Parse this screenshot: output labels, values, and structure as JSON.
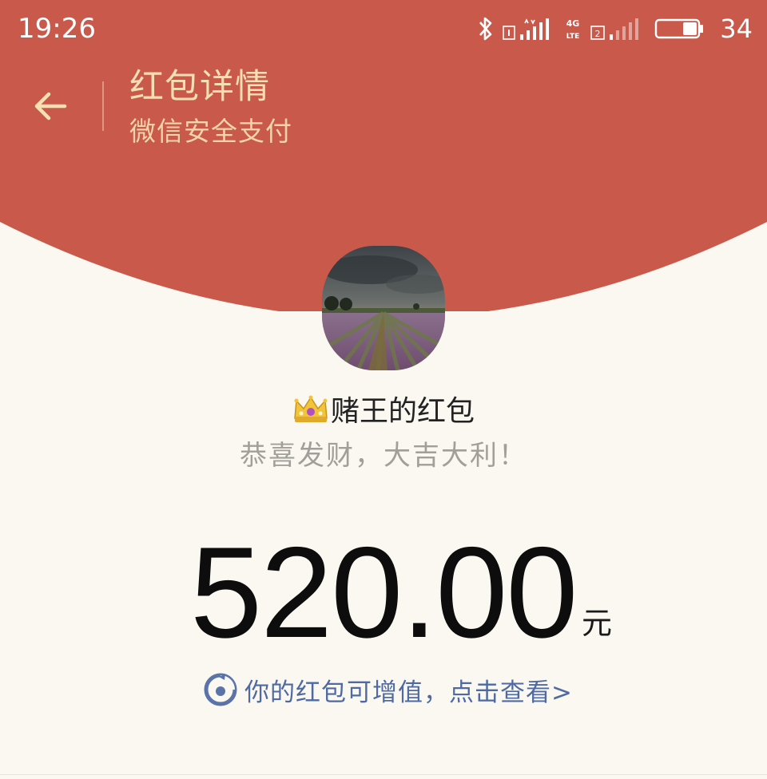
{
  "status_bar": {
    "time": "19:26",
    "battery_percent": "34",
    "icons": [
      "bluetooth-icon",
      "sim1-signal-icon",
      "4g-lte-icon",
      "sim2-signal-icon",
      "battery-icon"
    ]
  },
  "header": {
    "title": "红包详情",
    "subtitle": "微信安全支付",
    "back_icon": "back-arrow-icon"
  },
  "sender": {
    "emoji_icon": "crown-icon",
    "name": "赌王的红包",
    "greeting": "恭喜发财，大吉大利！"
  },
  "amount": {
    "value": "520.00",
    "unit": "元"
  },
  "upsell": {
    "text": "你的红包可增值，点击查看>",
    "icon": "licaitong-icon"
  },
  "colors": {
    "header_red": "#c9594b",
    "header_text": "#f5dfb4",
    "background": "#faf8f1",
    "link_blue": "#4f6aa2"
  }
}
